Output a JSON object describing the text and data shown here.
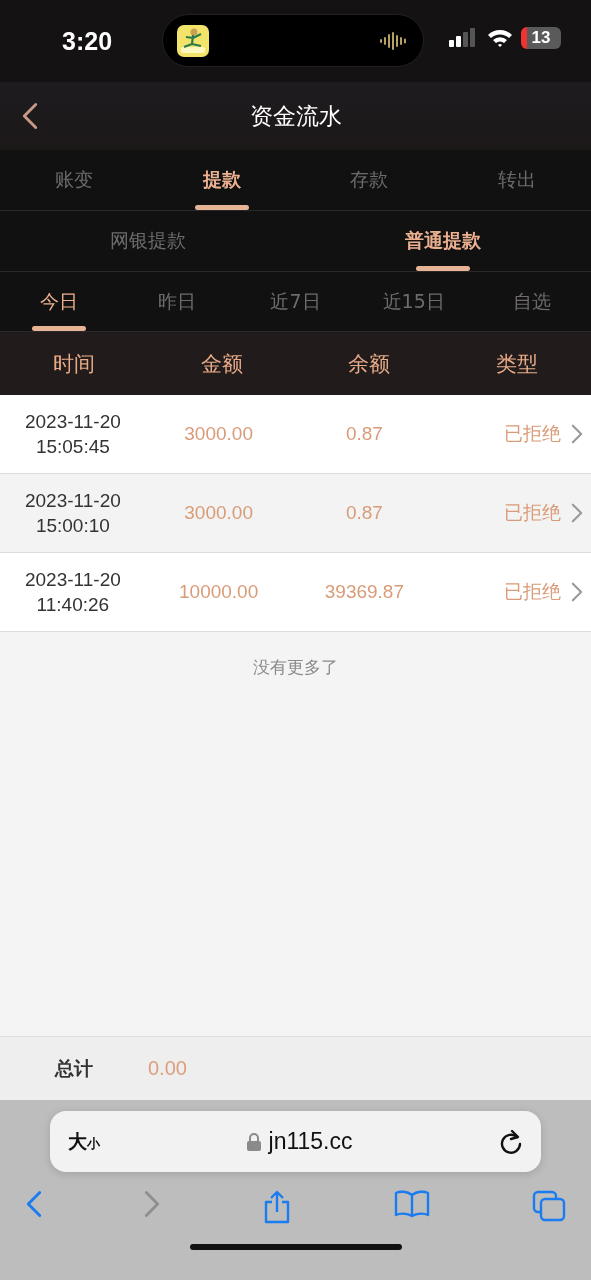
{
  "status_bar": {
    "time": "3:20",
    "battery": "13",
    "battery_low": true
  },
  "nav": {
    "title": "资金流水"
  },
  "tabs": [
    {
      "label": "账变",
      "selected": false
    },
    {
      "label": "提款",
      "selected": true
    },
    {
      "label": "存款",
      "selected": false
    },
    {
      "label": "转出",
      "selected": false
    }
  ],
  "sub_tabs": [
    {
      "label": "网银提款",
      "selected": false
    },
    {
      "label": "普通提款",
      "selected": true
    }
  ],
  "periods": [
    {
      "label": "今日",
      "selected": true
    },
    {
      "label": "昨日",
      "selected": false
    },
    {
      "label": "近7日",
      "selected": false
    },
    {
      "label": "近15日",
      "selected": false
    },
    {
      "label": "自选",
      "selected": false
    }
  ],
  "table": {
    "columns": [
      "时间",
      "金额",
      "余额",
      "类型"
    ],
    "rows": [
      {
        "date": "2023-11-20",
        "time": "15:05:45",
        "amount": "3000.00",
        "balance": "0.87",
        "type": "已拒绝",
        "selected": false
      },
      {
        "date": "2023-11-20",
        "time": "15:00:10",
        "amount": "3000.00",
        "balance": "0.87",
        "type": "已拒绝",
        "selected": true
      },
      {
        "date": "2023-11-20",
        "time": "11:40:26",
        "amount": "10000.00",
        "balance": "39369.87",
        "type": "已拒绝",
        "selected": false
      }
    ],
    "end_note": "没有更多了"
  },
  "total": {
    "label": "总计",
    "value": "0.00"
  },
  "browser": {
    "text_size": [
      "大",
      "小"
    ],
    "url": "jn115.cc",
    "forward_disabled": true
  }
}
